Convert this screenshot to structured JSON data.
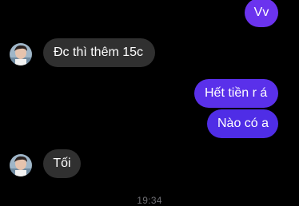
{
  "colors": {
    "background": "#000000",
    "sent_bubble": "#5b2ee8",
    "received_bubble": "#303030",
    "bubble_text": "#ffffff",
    "timestamp_text": "#6e6e73"
  },
  "messages": [
    {
      "direction": "outgoing",
      "text": "Vv"
    },
    {
      "direction": "incoming",
      "text": "Đc thì thêm 15c"
    },
    {
      "direction": "outgoing",
      "text": "Hết tiền r á"
    },
    {
      "direction": "outgoing",
      "text": "Nào có a"
    },
    {
      "direction": "incoming",
      "text": "Tối"
    }
  ],
  "timestamp": "19:34",
  "avatar": {
    "icon": "contact-avatar-photo"
  }
}
